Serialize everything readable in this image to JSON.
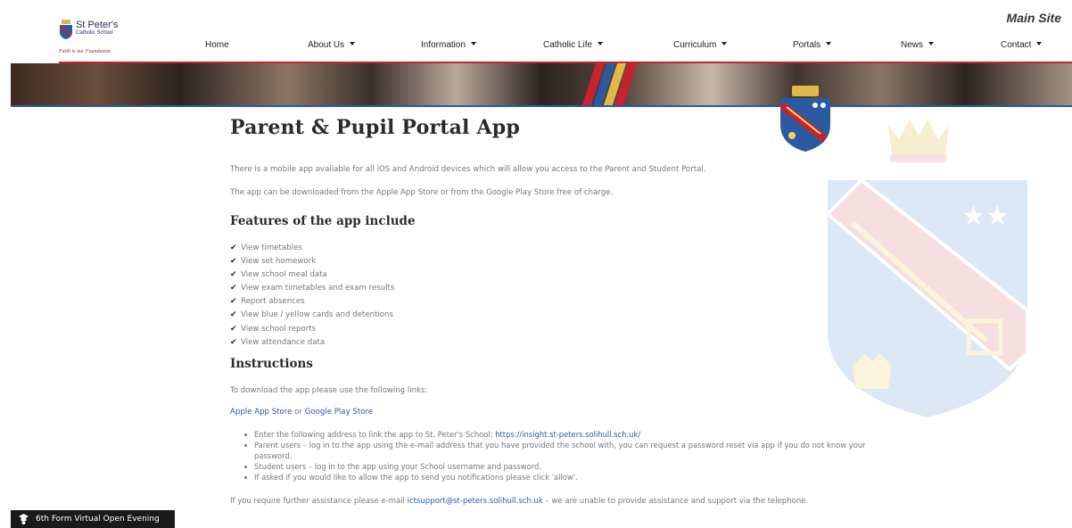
{
  "header": {
    "logo": {
      "name": "St Peter's",
      "subtitle": "Catholic School",
      "motto": "Faith is our Foundation"
    },
    "main_site_link": "Main Site",
    "nav": [
      {
        "label": "Home",
        "dropdown": false
      },
      {
        "label": "About Us",
        "dropdown": true
      },
      {
        "label": "Information",
        "dropdown": true
      },
      {
        "label": "Catholic Life",
        "dropdown": true
      },
      {
        "label": "Curriculum",
        "dropdown": true
      },
      {
        "label": "Portals",
        "dropdown": true
      },
      {
        "label": "News",
        "dropdown": true
      },
      {
        "label": "Contact",
        "dropdown": true
      }
    ]
  },
  "page": {
    "title": "Parent & Pupil Portal App",
    "intro_1": "There is a mobile app available for all iOS and Android devices which will allow you access to the Parent and Student Portal.",
    "intro_2": "The app can be downloaded from the Apple App Store or from the Google Play Store free of charge.",
    "features_heading": "Features of the app include",
    "features": [
      "View timetables",
      "View set homework",
      "View school meal data",
      "View exam timetables and exam results",
      "Report absences",
      "View blue / yellow cards and detentions",
      "View school reports",
      "View attendance data"
    ],
    "instructions_heading": "Instructions",
    "download_text": "To download the app please use the following links:",
    "apple_link": "Apple App Store",
    "or_text": " or ",
    "google_link": "Google Play Store",
    "steps": [
      {
        "text": "Enter the following address to link the app to St. Peter's School: ",
        "link": "https://insight.st-peters.solihull.sch.uk/"
      },
      {
        "text": "Parent users – log in to the app using the e-mail address that you have provided the school with, you can request a password reset via app if you do not know your password.",
        "link": ""
      },
      {
        "text": "Student users – log in to the app using your School username and password.",
        "link": ""
      },
      {
        "text": "If asked if you would like to allow the app to send you notifications please click 'allow'.",
        "link": ""
      }
    ],
    "help_prefix": "If you require further assistance please e-mail ",
    "help_email": "ictsupport@st-peters.solihull.sch.uk",
    "help_suffix": " – we are unable to provide assistance and support via the telephone."
  },
  "floating_badge": {
    "label": "6th Form Virtual Open Evening",
    "icon": "graduation-cap-icon"
  },
  "colors": {
    "accent_red": "#c8232c",
    "accent_blue": "#2c5aa0",
    "link": "#2b5aa8",
    "navy": "#1d2a5a",
    "crest_gold": "#f2d45c"
  }
}
